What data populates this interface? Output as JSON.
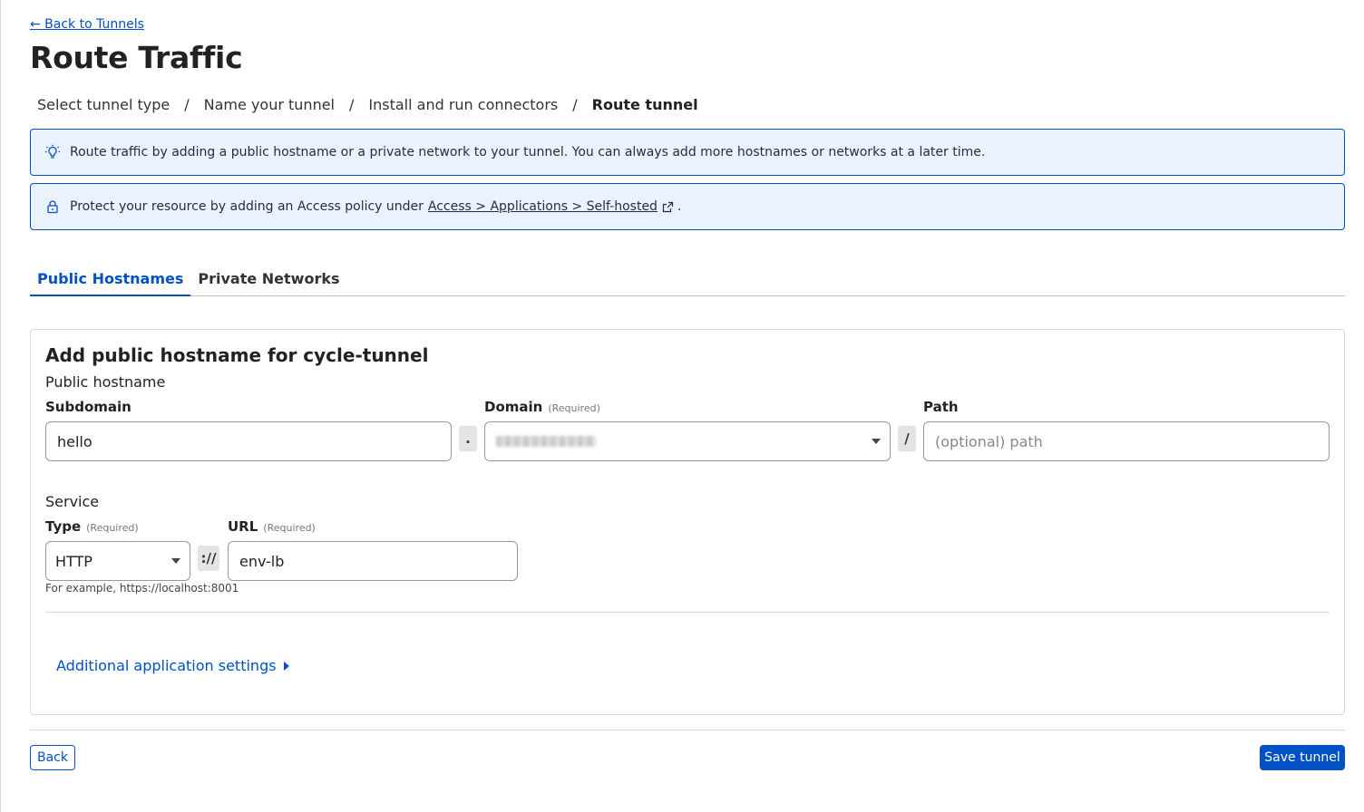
{
  "header": {
    "back_link": "← Back to Tunnels",
    "title": "Route Traffic"
  },
  "breadcrumb": {
    "steps": [
      "Select tunnel type",
      "Name your tunnel",
      "Install and run connectors",
      "Route tunnel"
    ],
    "separator": "/"
  },
  "banners": {
    "info_text": "Route traffic by adding a public hostname or a private network to your tunnel. You can always add more hostnames or networks at a later time.",
    "access_prefix": "Protect your resource by adding an Access policy under",
    "access_link": "Access > Applications > Self-hosted",
    "access_suffix": "."
  },
  "tabs": {
    "public": "Public Hostnames",
    "private": "Private Networks"
  },
  "card": {
    "title": "Add public hostname for cycle-tunnel",
    "hostname_section": "Public hostname",
    "subdomain_label": "Subdomain",
    "subdomain_value": "hello",
    "dot": ".",
    "domain_label": "Domain",
    "required": "(Required)",
    "slash": "/",
    "path_label": "Path",
    "path_placeholder": "(optional) path",
    "service_section": "Service",
    "type_label": "Type",
    "type_value": "HTTP",
    "scheme_sep": "://",
    "url_label": "URL",
    "url_value": "env-lb",
    "hint": "For example, https://localhost:8001",
    "more_settings": "Additional application settings"
  },
  "footer": {
    "back": "Back",
    "save": "Save tunnel"
  },
  "colors": {
    "accent": "#0051c3",
    "banner_bg": "#eaf3fd"
  }
}
